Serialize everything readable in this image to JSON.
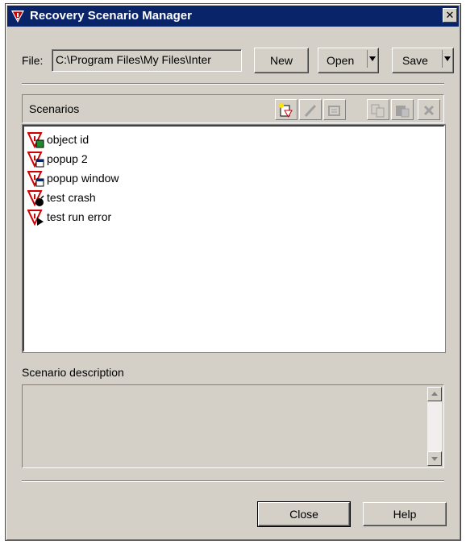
{
  "window": {
    "title": "Recovery Scenario Manager",
    "close_glyph": "✕"
  },
  "file": {
    "label": "File:",
    "value": "C:\\Program Files\\My Files\\Inter"
  },
  "buttons": {
    "new": "New",
    "open": "Open",
    "save": "Save",
    "close": "Close",
    "help": "Help"
  },
  "scenarios": {
    "header": "Scenarios",
    "toolbar": [
      "new-scenario-icon",
      "edit-icon",
      "properties-icon",
      "copy-icon",
      "paste-icon",
      "delete-icon"
    ],
    "items": [
      {
        "label": "object id",
        "icon": "object-state-icon"
      },
      {
        "label": "popup 2",
        "icon": "popup-window-icon"
      },
      {
        "label": "popup window",
        "icon": "popup-window-icon"
      },
      {
        "label": "test crash",
        "icon": "application-crash-icon"
      },
      {
        "label": "test run error",
        "icon": "test-run-error-icon"
      }
    ]
  },
  "description": {
    "label": "Scenario description",
    "value": ""
  },
  "colors": {
    "titlebar": "#0a246a",
    "face": "#d4d0c8",
    "accent_red": "#d00000"
  }
}
